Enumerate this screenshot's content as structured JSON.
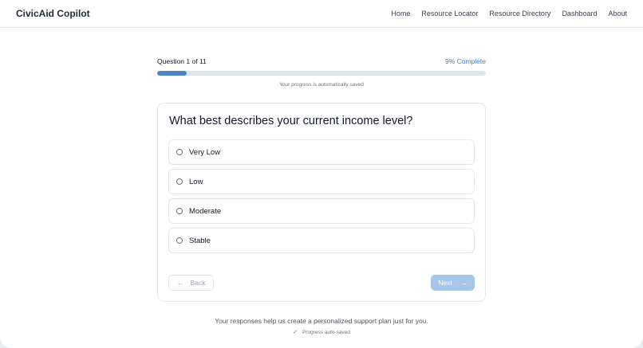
{
  "app": {
    "title": "CivicAid Copilot"
  },
  "nav": {
    "items": [
      {
        "label": "Home"
      },
      {
        "label": "Resource Locator"
      },
      {
        "label": "Resource Directory"
      },
      {
        "label": "Dashboard"
      },
      {
        "label": "About"
      }
    ]
  },
  "progress": {
    "question_text": "Question 1 of 11",
    "percent_text": "9% Complete",
    "value_percent": 9,
    "saved_note": "Your progress is automatically saved"
  },
  "question": {
    "text": "What best describes your current income level?",
    "options": [
      {
        "label": "Very Low"
      },
      {
        "label": "Low"
      },
      {
        "label": "Moderate"
      },
      {
        "label": "Stable"
      }
    ]
  },
  "buttons": {
    "back_label": "Back",
    "next_label": "Next"
  },
  "footer": {
    "note": "Your responses help us create a personalized support plan just for you.",
    "autosave": "Progress auto-saved"
  },
  "colors": {
    "accent": "#4a86c5",
    "next_disabled": "#a7c5e8",
    "track": "#dbe5f0"
  },
  "icons": {
    "back": "arrow-left-icon",
    "next": "arrow-right-icon",
    "check": "check-icon"
  }
}
